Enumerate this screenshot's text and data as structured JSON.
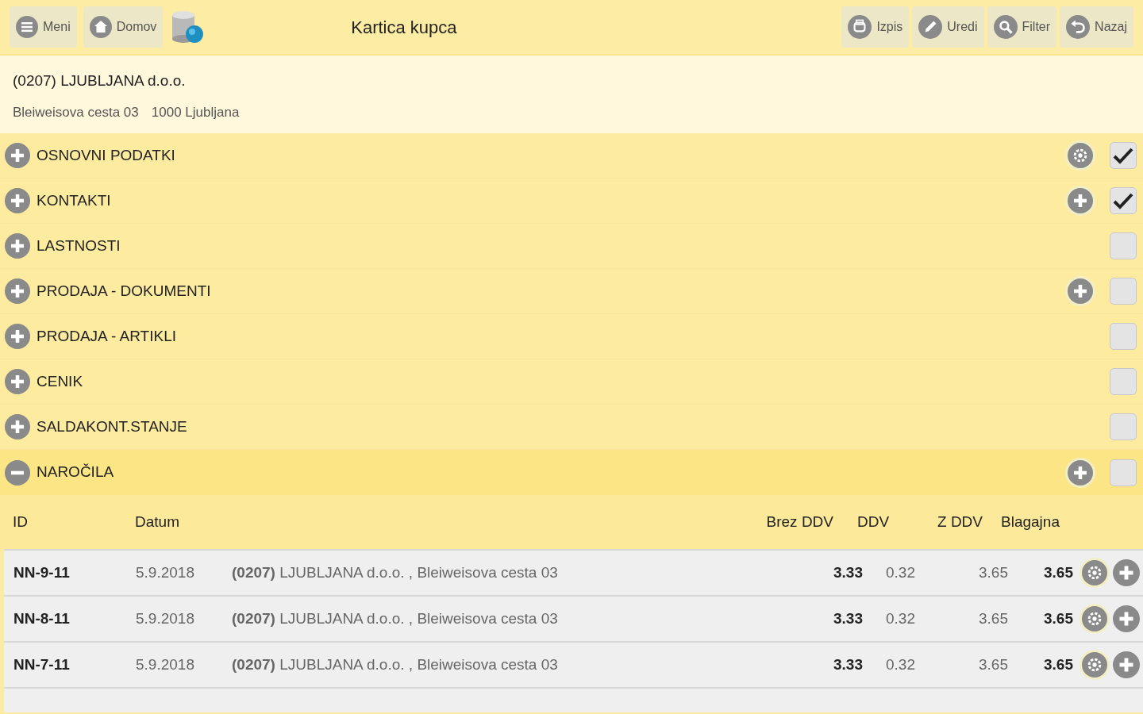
{
  "toolbar": {
    "left_buttons": [
      {
        "label": "Meni"
      },
      {
        "label": "Domov"
      }
    ],
    "title": "Kartica kupca",
    "right_buttons": [
      {
        "label": "Izpis"
      },
      {
        "label": "Uredi"
      },
      {
        "label": "Filter"
      },
      {
        "label": "Nazaj"
      }
    ]
  },
  "customer": {
    "name": "(0207) LJUBLJANA d.o.o.",
    "street": "Bleiweisova cesta 03",
    "city": "1000 Ljubljana"
  },
  "sections": [
    {
      "label": "OSNOVNI PODATKI",
      "expanded": false,
      "kind": "settings",
      "checked": true
    },
    {
      "label": "KONTAKTI",
      "expanded": false,
      "kind": "add",
      "checked": true
    },
    {
      "label": "LASTNOSTI",
      "expanded": false,
      "kind": "plain",
      "checked": false
    },
    {
      "label": "PRODAJA - DOKUMENTI",
      "expanded": false,
      "kind": "add",
      "checked": false
    },
    {
      "label": "PRODAJA - ARTIKLI",
      "expanded": false,
      "kind": "plain",
      "checked": false
    },
    {
      "label": "CENIK",
      "expanded": false,
      "kind": "plain",
      "checked": false
    },
    {
      "label": "SALDAKONT.STANJE",
      "expanded": false,
      "kind": "plain",
      "checked": false
    },
    {
      "label": "NAROČILA",
      "expanded": true,
      "kind": "add",
      "checked": false
    }
  ],
  "orders": {
    "columns": [
      "ID",
      "Datum",
      "Brez DDV",
      "DDV",
      "Z DDV",
      "Blagajna"
    ],
    "rows": [
      {
        "id": "NN-9-11",
        "date": "5.9.2018",
        "customer": "**(0207)** LJUBLJANA d.o.o. , Bleiweisova cesta 03",
        "net": "3.33",
        "vat": "0.32",
        "gross": "3.65",
        "cash": "3.65"
      },
      {
        "id": "NN-8-11",
        "date": "5.9.2018",
        "customer": "**(0207)** LJUBLJANA d.o.o. , Bleiweisova cesta 03",
        "net": "3.33",
        "vat": "0.32",
        "gross": "3.65",
        "cash": "3.65"
      },
      {
        "id": "NN-7-11",
        "date": "5.9.2018",
        "customer": "**(0207)** LJUBLJANA d.o.o. , Bleiweisova cesta 03",
        "net": "3.33",
        "vat": "0.32",
        "gross": "3.65",
        "cash": "3.65"
      }
    ]
  }
}
